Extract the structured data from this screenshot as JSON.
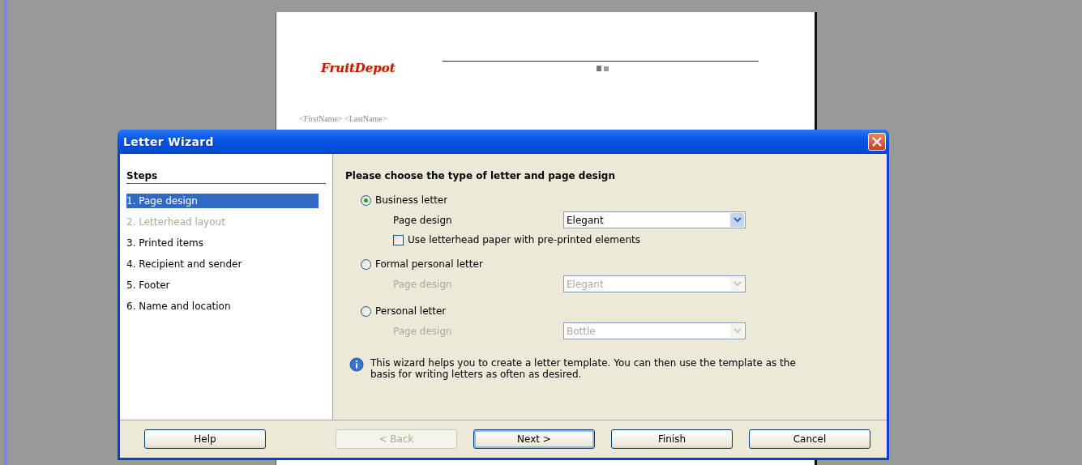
{
  "document": {
    "logo": "FruitDepot",
    "recipient": "<FirstName> <LastName>"
  },
  "window": {
    "title": "Letter Wizard"
  },
  "steps": {
    "heading": "Steps",
    "items": [
      {
        "label": "1. Page design",
        "selected": true,
        "disabled": false
      },
      {
        "label": "2. Letterhead layout",
        "selected": false,
        "disabled": true
      },
      {
        "label": "3. Printed items",
        "selected": false,
        "disabled": false
      },
      {
        "label": "4. Recipient and sender",
        "selected": false,
        "disabled": false
      },
      {
        "label": "5. Footer",
        "selected": false,
        "disabled": false
      },
      {
        "label": "6. Name and location",
        "selected": false,
        "disabled": false
      }
    ]
  },
  "heading": "Please choose the type of letter and page design",
  "letter_types": [
    {
      "label": "Business letter",
      "selected": true,
      "design_label": "Page design",
      "design_value": "Elegant",
      "disabled": false,
      "option": {
        "label": "Use letterhead paper with pre-printed elements",
        "checked": false
      }
    },
    {
      "label": "Formal personal letter",
      "selected": false,
      "design_label": "Page design",
      "design_value": "Elegant",
      "disabled": true
    },
    {
      "label": "Personal letter",
      "selected": false,
      "design_label": "Page design",
      "design_value": "Bottle",
      "disabled": true
    }
  ],
  "info": "This wizard helps you to create a letter template. You can then use the template as the basis for writing letters as often as desired.",
  "buttons": [
    {
      "label": "Help",
      "disabled": false,
      "default": false
    },
    {
      "label": "< Back",
      "disabled": true,
      "default": false
    },
    {
      "label": "Next >",
      "disabled": false,
      "default": true
    },
    {
      "label": "Finish",
      "disabled": false,
      "default": false
    },
    {
      "label": "Cancel",
      "disabled": false,
      "default": false
    }
  ]
}
